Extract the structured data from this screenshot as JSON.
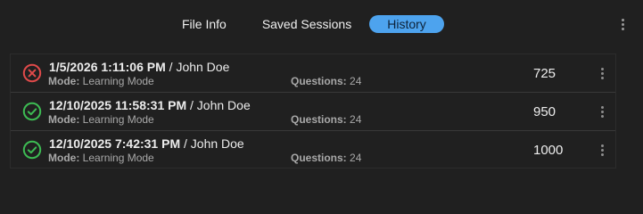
{
  "tabs": [
    {
      "label": "File Info",
      "active": false
    },
    {
      "label": "Saved Sessions",
      "active": false
    },
    {
      "label": "History",
      "active": true
    }
  ],
  "colors": {
    "background": "#202020",
    "accent": "#4da3ee",
    "fail": "#e04a4a",
    "pass": "#3dbb53"
  },
  "history": [
    {
      "status": "fail",
      "status_icon": "x-circle-icon",
      "date": "1/5/2026 1:11:06 PM",
      "separator": "/",
      "user": "John Doe",
      "mode_label": "Mode:",
      "mode": "Learning Mode",
      "questions_label": "Questions:",
      "questions": "24",
      "score": "725"
    },
    {
      "status": "pass",
      "status_icon": "check-circle-icon",
      "date": "12/10/2025 11:58:31 PM",
      "separator": "/",
      "user": "John Doe",
      "mode_label": "Mode:",
      "mode": "Learning Mode",
      "questions_label": "Questions:",
      "questions": "24",
      "score": "950"
    },
    {
      "status": "pass",
      "status_icon": "check-circle-icon",
      "date": "12/10/2025 7:42:31 PM",
      "separator": "/",
      "user": "John Doe",
      "mode_label": "Mode:",
      "mode": "Learning Mode",
      "questions_label": "Questions:",
      "questions": "24",
      "score": "1000"
    }
  ]
}
